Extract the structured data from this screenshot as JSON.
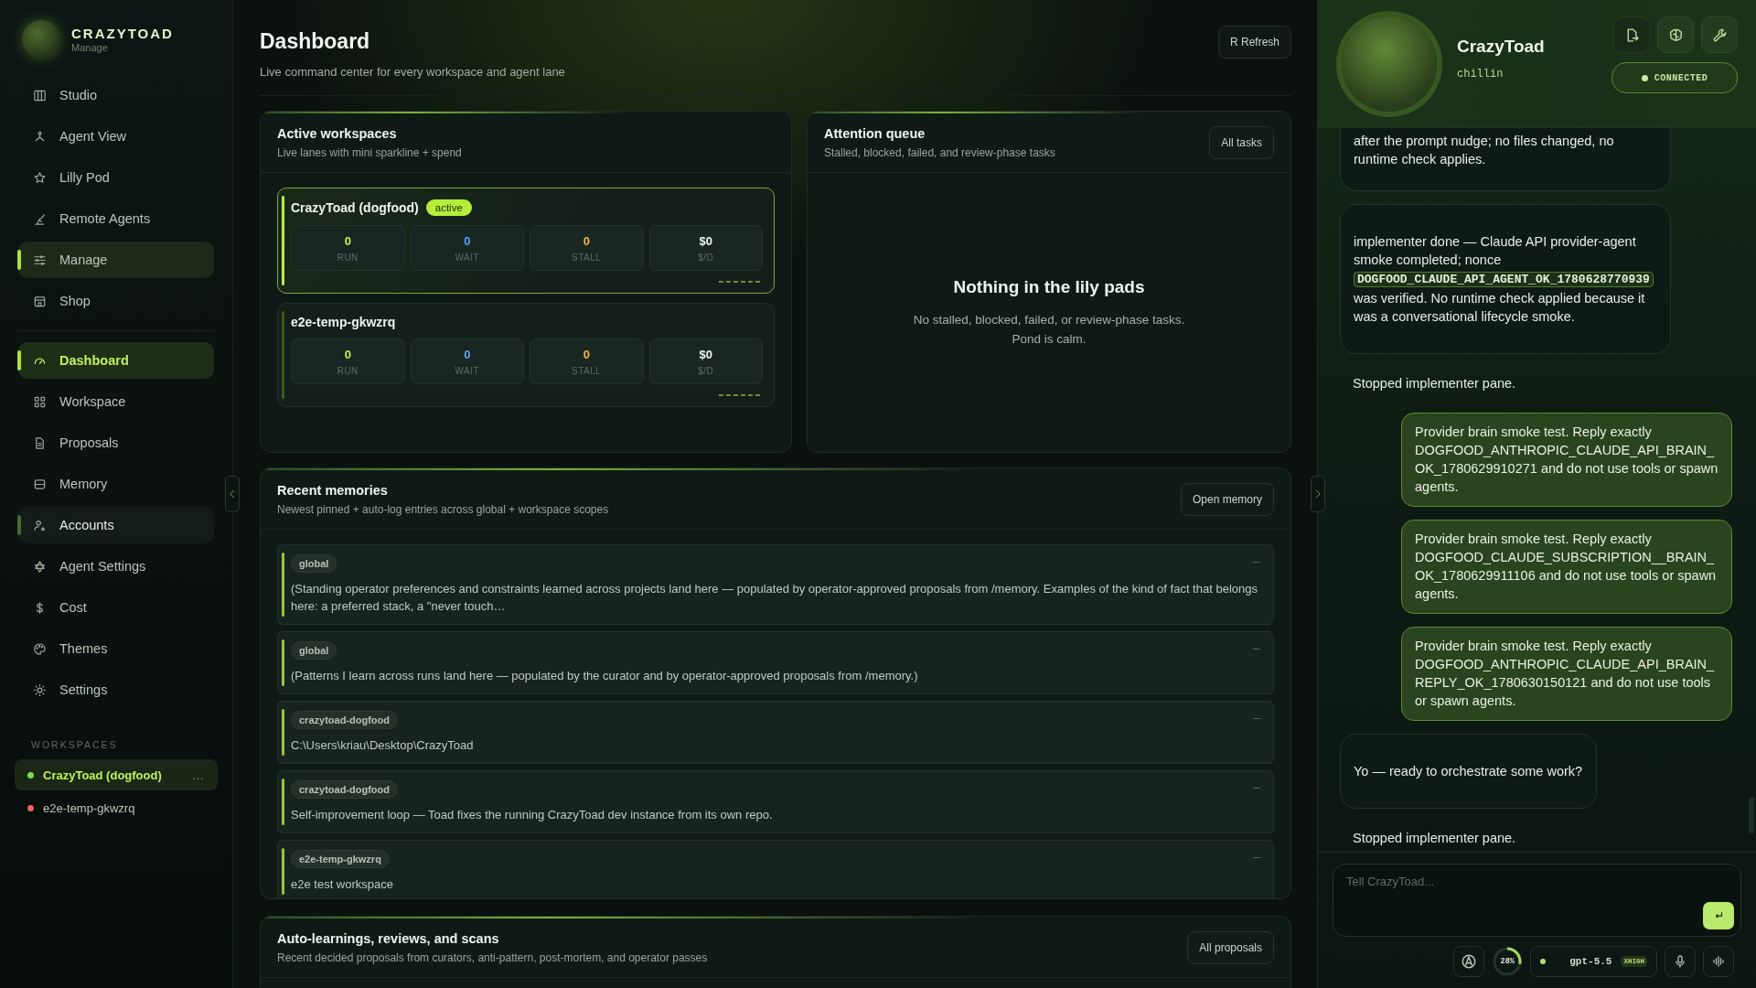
{
  "brand": {
    "name": "CRAZYTOAD",
    "subtitle": "Manage"
  },
  "nav_top": [
    {
      "label": "Studio",
      "selected": false,
      "open": false,
      "hovered": false
    },
    {
      "label": "Agent View",
      "selected": false,
      "open": false,
      "hovered": false
    },
    {
      "label": "Lilly Pod",
      "selected": false,
      "open": false,
      "hovered": false
    },
    {
      "label": "Remote Agents",
      "selected": false,
      "open": false,
      "hovered": false
    },
    {
      "label": "Manage",
      "selected": false,
      "open": true,
      "hovered": false
    },
    {
      "label": "Shop",
      "selected": false,
      "open": false,
      "hovered": false
    }
  ],
  "nav_main": [
    {
      "label": "Dashboard",
      "selected": true,
      "open": false,
      "hovered": false
    },
    {
      "label": "Workspace",
      "selected": false,
      "open": false,
      "hovered": false
    },
    {
      "label": "Proposals",
      "selected": false,
      "open": false,
      "hovered": false
    },
    {
      "label": "Memory",
      "selected": false,
      "open": false,
      "hovered": false
    },
    {
      "label": "Accounts",
      "selected": false,
      "open": false,
      "hovered": true
    },
    {
      "label": "Agent Settings",
      "selected": false,
      "open": false,
      "hovered": false
    },
    {
      "label": "Cost",
      "selected": false,
      "open": false,
      "hovered": false
    },
    {
      "label": "Themes",
      "selected": false,
      "open": false,
      "hovered": false
    },
    {
      "label": "Settings",
      "selected": false,
      "open": false,
      "hovered": false
    }
  ],
  "workspaces": {
    "heading": "WORKSPACES",
    "items": [
      {
        "name": "CrazyToad (dogfood)",
        "color": "#7ed957",
        "selected": true,
        "menu": "…"
      },
      {
        "name": "e2e-temp-gkwzrq",
        "color": "#f06060",
        "selected": false
      }
    ]
  },
  "header": {
    "title": "Dashboard",
    "subtitle": "Live command center for every workspace and agent lane",
    "refresh": "R Refresh"
  },
  "active_workspaces": {
    "title": "Active workspaces",
    "subtitle": "Live lanes with mini sparkline + spend",
    "lanes": [
      {
        "name": "CrazyToad (dogfood)",
        "badge": "active",
        "selected": true,
        "stats": [
          {
            "kind": "run",
            "value": "0",
            "label": "RUN"
          },
          {
            "kind": "wait",
            "value": "0",
            "label": "WAIT"
          },
          {
            "kind": "stall",
            "value": "0",
            "label": "STALL"
          },
          {
            "kind": "spend",
            "value": "$0",
            "label": "$/D"
          }
        ]
      },
      {
        "name": "e2e-temp-gkwzrq",
        "selected": false,
        "stats": [
          {
            "kind": "run",
            "value": "0",
            "label": "RUN"
          },
          {
            "kind": "wait",
            "value": "0",
            "label": "WAIT"
          },
          {
            "kind": "stall",
            "value": "0",
            "label": "STALL"
          },
          {
            "kind": "spend",
            "value": "$0",
            "label": "$/D"
          }
        ]
      }
    ]
  },
  "attention_queue": {
    "title": "Attention queue",
    "subtitle": "Stalled, blocked, failed, and review-phase tasks",
    "button": "All tasks",
    "empty_title": "Nothing in the lily pads",
    "empty_lines": [
      "No stalled, blocked, failed, or review-phase tasks.",
      "Pond is calm."
    ]
  },
  "recent_memories": {
    "title": "Recent memories",
    "subtitle": "Newest pinned + auto-log entries across global + workspace scopes",
    "button": "Open memory",
    "entries": [
      {
        "scope": "global",
        "text": "(Standing operator preferences and constraints learned across projects land here — populated by operator-approved proposals from /memory. Examples of the kind of fact that belongs here: a preferred stack, a \"never touch…"
      },
      {
        "scope": "global",
        "text": "(Patterns I learn across runs land here — populated by the curator and by operator-approved proposals from /memory.)"
      },
      {
        "scope": "crazytoad-dogfood",
        "text": "C:\\Users\\kriau\\Desktop\\CrazyToad"
      },
      {
        "scope": "crazytoad-dogfood",
        "text": "Self-improvement loop — Toad fixes the running CrazyToad dev instance from its own repo."
      },
      {
        "scope": "e2e-temp-gkwzrq",
        "text": "e2e test workspace"
      }
    ]
  },
  "auto_learnings": {
    "title": "Auto-learnings, reviews, and scans",
    "subtitle": "Recent decided proposals from curators, anti-pattern, post-mortem, and operator passes",
    "button": "All proposals"
  },
  "chat": {
    "agent": {
      "name": "CrazyToad",
      "status": "chillin"
    },
    "connection": {
      "label": "CONNECTED",
      "connected": true
    },
    "messages": [
      {
        "kind": "agent",
        "cut_top": true,
        "text": "after the prompt nudge; no files changed, no runtime check applies."
      },
      {
        "kind": "agent",
        "cut_top": false,
        "text": "implementer done — Claude API provider-agent smoke completed; nonce",
        "code": "DOGFOOD_CLAUDE_API_AGENT_OK_1780628770939",
        "after": "was verified. No runtime check applied because it was a conversational lifecycle smoke."
      },
      {
        "kind": "note",
        "text": "Stopped implementer pane."
      },
      {
        "kind": "user",
        "text": "Provider brain smoke test. Reply exactly DOGFOOD_ANTHROPIC_CLAUDE_API_BRAIN_OK_1780629910271 and do not use tools or spawn agents."
      },
      {
        "kind": "user",
        "text": "Provider brain smoke test. Reply exactly DOGFOOD_CLAUDE_SUBSCRIPTION__BRAIN_OK_1780629911106 and do not use tools or spawn agents."
      },
      {
        "kind": "user",
        "text": "Provider brain smoke test. Reply exactly DOGFOOD_ANTHROPIC_CLAUDE_API_BRAIN_REPLY_OK_1780630150121 and do not use tools or spawn agents."
      },
      {
        "kind": "agent",
        "cut_top": false,
        "text": "Yo — ready to orchestrate some work?"
      },
      {
        "kind": "note",
        "text": "Stopped implementer pane."
      }
    ],
    "composer": {
      "placeholder": "Tell CrazyToad..."
    },
    "usage": {
      "label": "28%",
      "level": 0.28
    },
    "model": {
      "name": "gpt-5.5",
      "effort": "XHIGH"
    }
  }
}
